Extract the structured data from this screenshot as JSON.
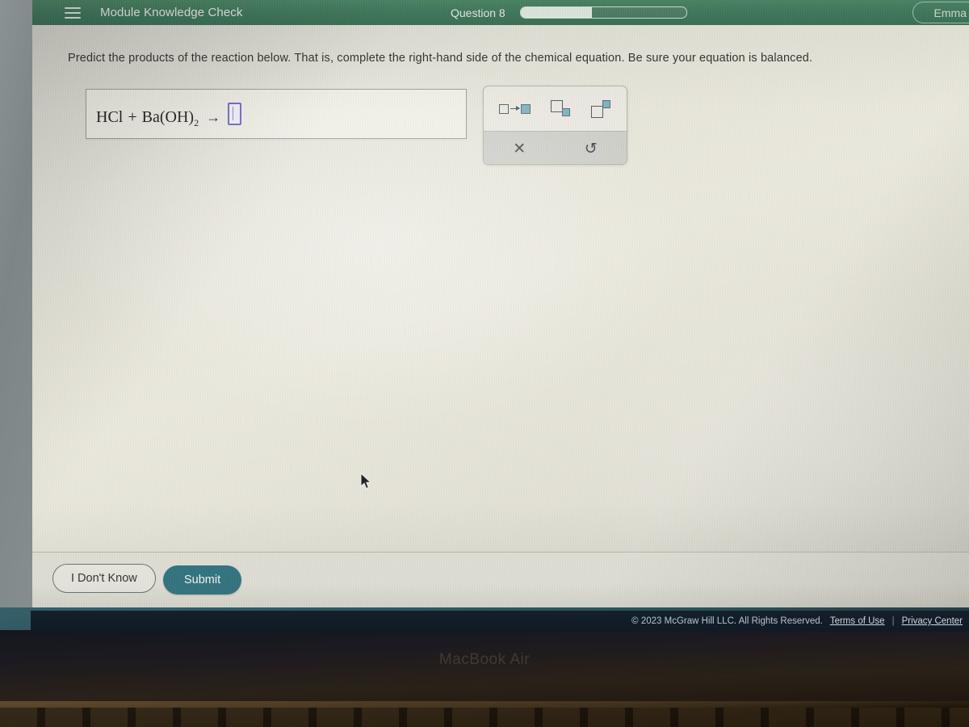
{
  "header": {
    "menu_icon": "hamburger-menu-icon",
    "title": "Module Knowledge Check",
    "question_label": "Question 8",
    "progress_percent": 43,
    "user_name": "Emma",
    "bg_color": "#357055"
  },
  "main": {
    "prompt": "Predict the products of the reaction below. That is, complete the right-hand side of the chemical equation. Be sure your equation is balanced.",
    "equation": {
      "reactant_1": "HCl",
      "plus": "+",
      "reactant_2_formula": "Ba(OH)",
      "reactant_2_subscript": "2",
      "arrow": "→",
      "answer_placeholder": "",
      "slot_color": "#6b63c4"
    }
  },
  "palette": {
    "buttons": [
      {
        "name": "reaction-arrow-icon",
        "label": "□→□"
      },
      {
        "name": "subscript-icon",
        "label": "□₂"
      },
      {
        "name": "superscript-icon",
        "label": "□²"
      }
    ],
    "clear_glyph": "✕",
    "undo_glyph": "↺"
  },
  "actions": {
    "dont_know_label": "I Don't Know",
    "submit_label": "Submit",
    "submit_color": "#2c7380"
  },
  "footer": {
    "copyright": "© 2023 McGraw Hill LLC. All Rights Reserved.",
    "terms_label": "Terms of Use",
    "separator": "|",
    "privacy_label": "Privacy Center"
  },
  "device": {
    "model_label": "MacBook Air"
  }
}
